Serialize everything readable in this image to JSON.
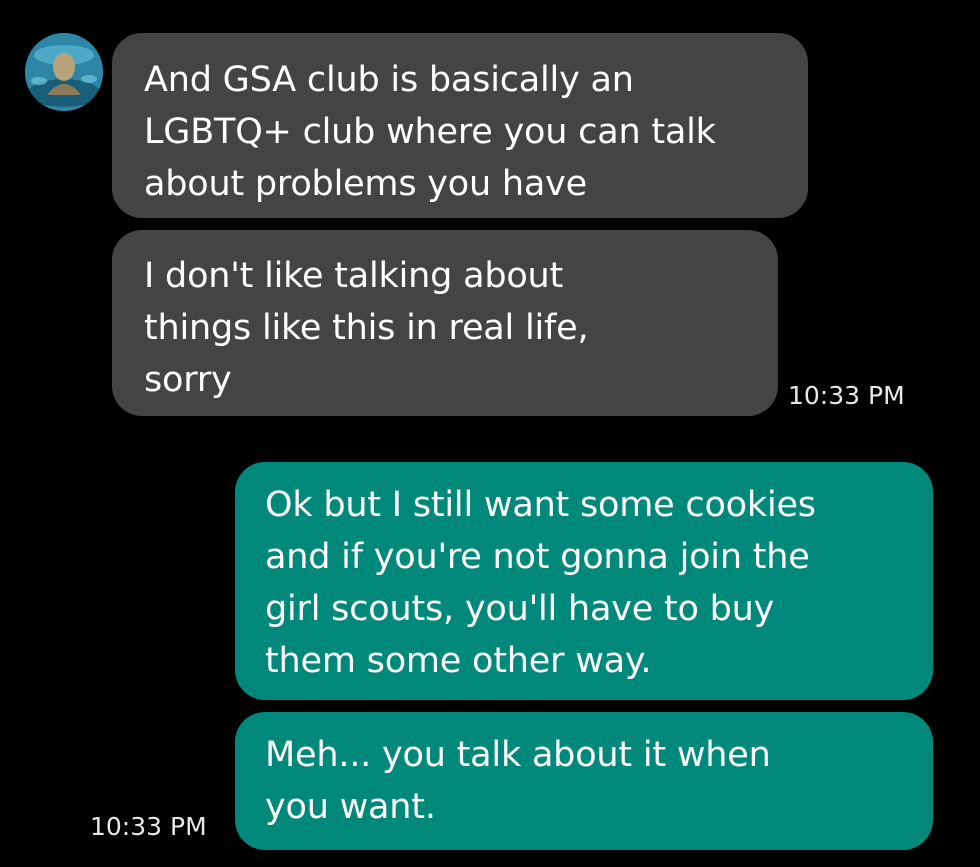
{
  "contact": {
    "avatar_icon": "profile-photo-avatar"
  },
  "messages": [
    {
      "direction": "incoming",
      "text": "And GSA club is basically an\nLGBTQ+ club where you can talk\nabout problems you have"
    },
    {
      "direction": "incoming",
      "text": "I don't like talking about\nthings like this in real life,\nsorry"
    },
    {
      "direction": "outgoing",
      "text": "Ok but I still want some cookies\nand if you're not gonna join the\ngirl scouts, you'll have to buy\nthem some other way."
    },
    {
      "direction": "outgoing",
      "text": "Meh... you talk about it when\nyou want."
    }
  ],
  "timestamps": {
    "incoming_group": "10:33 PM",
    "outgoing_group": "10:33 PM"
  },
  "colors": {
    "background": "#000000",
    "incoming_bubble": "#444446",
    "outgoing_bubble": "#00897b",
    "text": "#ffffff"
  }
}
